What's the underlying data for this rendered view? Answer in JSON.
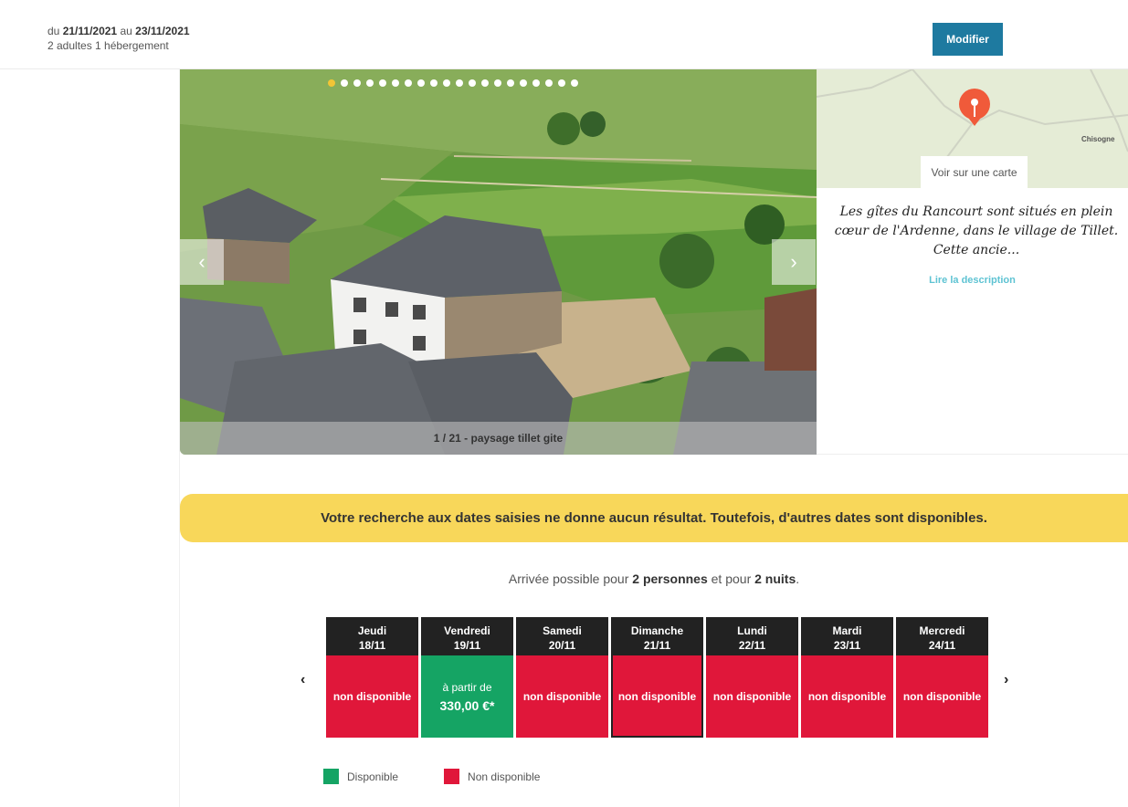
{
  "search": {
    "from_prefix": "du",
    "from_date": "21/11/2021",
    "to_prefix": "au",
    "to_date": "23/11/2021",
    "guests": "2 adultes 1 hébergement",
    "modify_label": "Modifier"
  },
  "gallery": {
    "dot_count": 20,
    "active_dot": 0,
    "caption": "1 / 21 - paysage tillet gite",
    "prev_arrow": "‹",
    "next_arrow": "›"
  },
  "map": {
    "town_label": "Chisogne",
    "button_label": "Voir sur une carte"
  },
  "description": {
    "text": "Les gîtes du Rancourt sont situés en plein cœur de l'Ardenne, dans le village de Tillet. Cette ancie...",
    "read_more": "Lire la description"
  },
  "availability": {
    "notice": "Votre recherche aux dates saisies ne donne aucun résultat. Toutefois, d'autres dates sont disponibles.",
    "arrivee_prefix": "Arrivée possible pour",
    "persons": "2 personnes",
    "arrivee_mid": "et pour",
    "nights": "2 nuits",
    "arrivee_suffix": ".",
    "prev": "‹",
    "next": "›",
    "days": [
      {
        "name": "Jeudi",
        "date": "18/11",
        "status": "non disponible",
        "available": false
      },
      {
        "name": "Vendredi",
        "date": "19/11",
        "status": "à partir de",
        "price": "330,00 €*",
        "available": true
      },
      {
        "name": "Samedi",
        "date": "20/11",
        "status": "non disponible",
        "available": false
      },
      {
        "name": "Dimanche",
        "date": "21/11",
        "status": "non disponible",
        "available": false,
        "selected": true
      },
      {
        "name": "Lundi",
        "date": "22/11",
        "status": "non disponible",
        "available": false
      },
      {
        "name": "Mardi",
        "date": "23/11",
        "status": "non disponible",
        "available": false
      },
      {
        "name": "Mercredi",
        "date": "24/11",
        "status": "non disponible",
        "available": false
      }
    ],
    "legend": {
      "available": "Disponible",
      "unavailable": "Non disponible",
      "available_color": "#15a464",
      "unavailable_color": "#e0173a"
    }
  }
}
